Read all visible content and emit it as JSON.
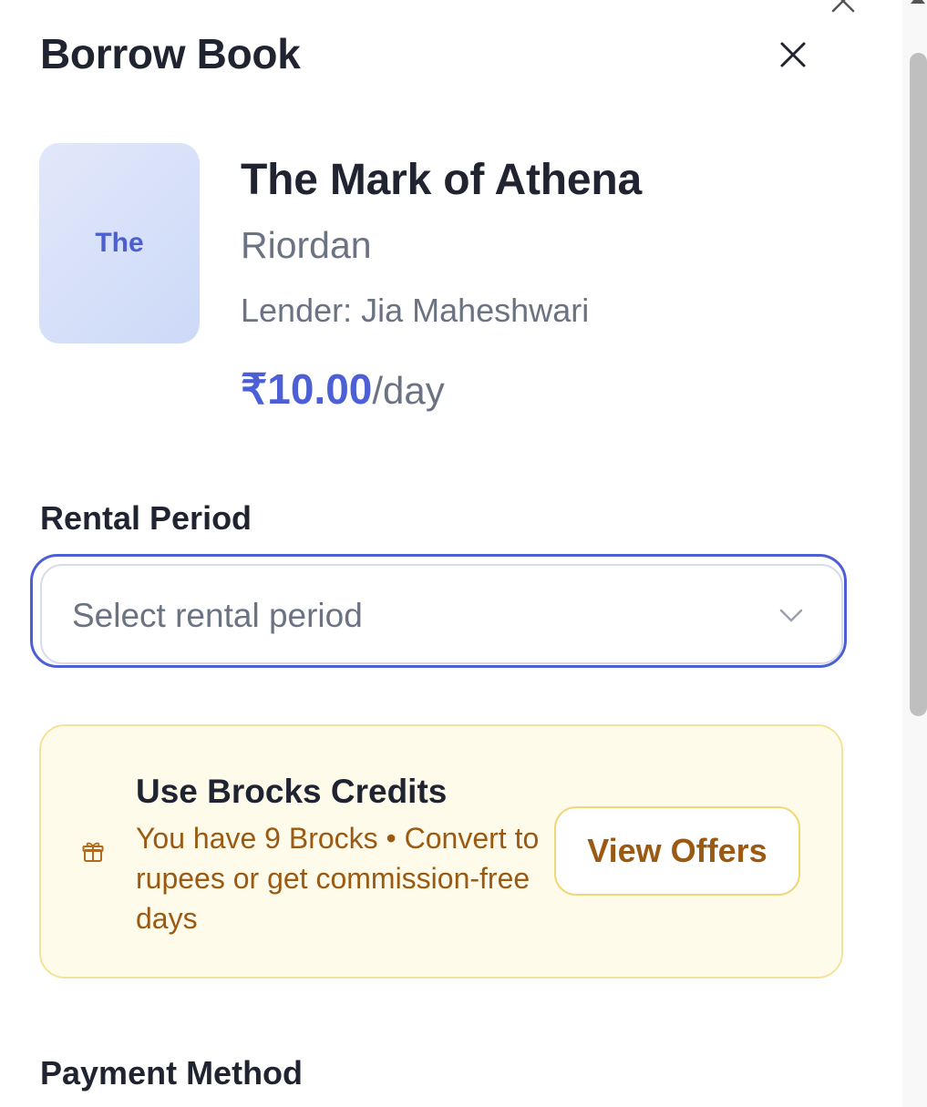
{
  "dialog": {
    "title": "Borrow Book",
    "close_icon": "close-icon"
  },
  "book": {
    "cover_text": "The",
    "title": "The Mark of Athena",
    "author": "Riordan",
    "lender": "Lender: Jia Maheshwari",
    "price": "₹10.00",
    "price_unit": "/day"
  },
  "rental": {
    "label": "Rental Period",
    "placeholder": "Select rental period",
    "chevron_icon": "chevron-down-icon"
  },
  "credits": {
    "icon": "gift-icon",
    "title": "Use Brocks Credits",
    "text": "You have 9 Brocks • Convert to rupees or get commission-free days",
    "button_label": "View Offers"
  },
  "payment": {
    "label": "Payment Method"
  },
  "colors": {
    "accent": "#4c5fd5",
    "credits_bg": "#fefbea",
    "credits_text": "#9a5a13"
  }
}
